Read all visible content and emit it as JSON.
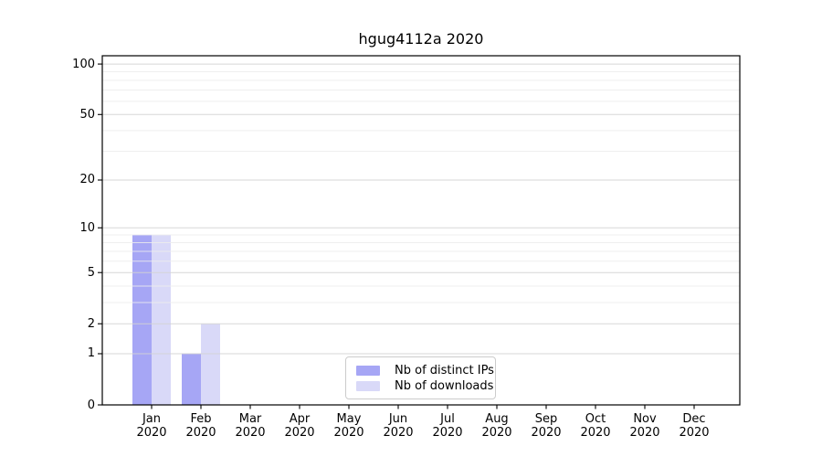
{
  "chart_data": {
    "type": "bar",
    "title": "hgug4112a 2020",
    "x_year": "2020",
    "categories": [
      "Jan",
      "Feb",
      "Mar",
      "Apr",
      "May",
      "Jun",
      "Jul",
      "Aug",
      "Sep",
      "Oct",
      "Nov",
      "Dec"
    ],
    "series": [
      {
        "name": "Nb of distinct IPs",
        "color": "#a6a6f5",
        "values": [
          9,
          1,
          0,
          0,
          0,
          0,
          0,
          0,
          0,
          0,
          0,
          0
        ]
      },
      {
        "name": "Nb of downloads",
        "color": "#d9d9f8",
        "values": [
          9,
          2,
          0,
          0,
          0,
          0,
          0,
          0,
          0,
          0,
          0,
          0
        ]
      }
    ],
    "y_axis": {
      "scale": "log1p",
      "ticks": [
        0,
        1,
        2,
        5,
        10,
        20,
        50,
        100
      ],
      "minor_gridlines": [
        3,
        4,
        6,
        7,
        8,
        9,
        30,
        40,
        60,
        70,
        80,
        90
      ],
      "ylim": [
        0,
        112
      ]
    },
    "xlabel": "",
    "ylabel": "",
    "grid": true,
    "legend": {
      "position": "lower center"
    },
    "colors": {
      "major_grid": "#d3d3d3",
      "minor_grid": "#ececec",
      "spine": "#000000",
      "tick": "#000000",
      "text": "#000000",
      "legend_border": "#cccccc"
    }
  }
}
